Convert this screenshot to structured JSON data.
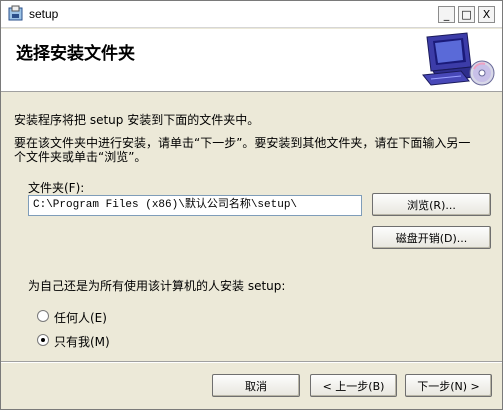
{
  "window": {
    "title": "setup",
    "min_symbol": "_",
    "max_symbol": "□",
    "close_symbol": "X"
  },
  "banner": {
    "title": "选择安装文件夹"
  },
  "body": {
    "line1": "安装程序将把 setup 安装到下面的文件夹中。",
    "line2": "要在该文件夹中进行安装，请单击“下一步”。要安装到其他文件夹，请在下面输入另一",
    "line3": "个文件夹或单击“浏览”。"
  },
  "folder": {
    "label": "文件夹(F):",
    "value": "C:\\Program Files (x86)\\默认公司名称\\setup\\",
    "browse_label": "浏览(R)...",
    "disk_cost_label": "磁盘开销(D)..."
  },
  "install_for": {
    "question": "为自己还是为所有使用该计算机的人安装 setup:",
    "options": [
      {
        "label": "任何人(E)",
        "selected": false
      },
      {
        "label": "只有我(M)",
        "selected": true
      }
    ]
  },
  "footer": {
    "cancel_label": "取消",
    "back_label": "< 上一步(B)",
    "next_label": "下一步(N) >"
  }
}
